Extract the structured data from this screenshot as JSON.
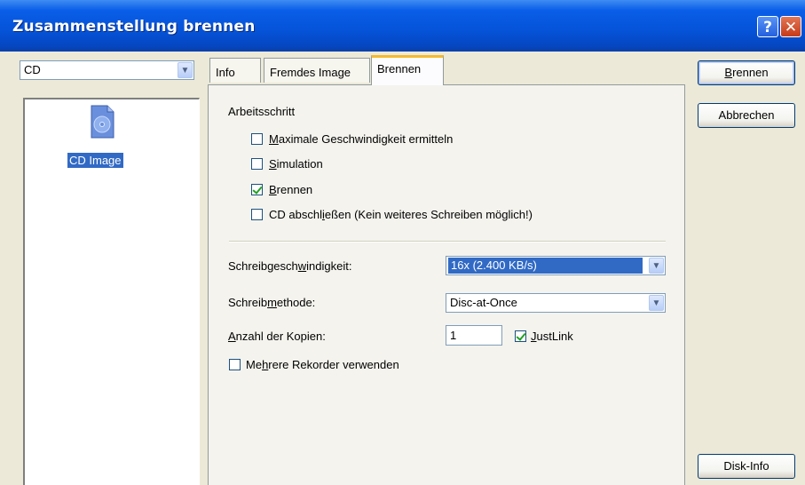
{
  "window": {
    "title": "Zusammenstellung brennen"
  },
  "left": {
    "combo_value": "CD",
    "items": [
      {
        "label": "CD Image",
        "icon": "cd-image-icon"
      }
    ]
  },
  "tabs": [
    {
      "label": "Info"
    },
    {
      "label": "Fremdes Image"
    },
    {
      "label": "Brennen",
      "active": true
    }
  ],
  "burn": {
    "group_label": "Arbeitsschritt",
    "options": [
      {
        "pre": "",
        "key": "M",
        "post": "aximale Geschwindigkeit ermitteln",
        "checked": false
      },
      {
        "pre": "",
        "key": "S",
        "post": "imulation",
        "checked": false
      },
      {
        "pre": "",
        "key": "B",
        "post": "rennen",
        "checked": true
      },
      {
        "pre": "CD abschl",
        "key": "i",
        "post": "eßen (Kein weiteres Schreiben möglich!)",
        "checked": false
      }
    ],
    "speed": {
      "pre": "Schreibgesch",
      "key": "w",
      "post": "indigkeit:",
      "value": "16x (2.400 KB/s)"
    },
    "method": {
      "pre": "Schreib",
      "key": "m",
      "post": "ethode:",
      "value": "Disc-at-Once"
    },
    "copies": {
      "pre": "",
      "key": "A",
      "post": "nzahl der Kopien:",
      "value": "1"
    },
    "justlink": {
      "pre": "",
      "key": "J",
      "post": "ustLink",
      "checked": true
    },
    "multi": {
      "pre": "Me",
      "key": "h",
      "post": "rere Rekorder verwenden",
      "checked": false
    }
  },
  "buttons": {
    "burn": {
      "key": "B",
      "post": "rennen"
    },
    "cancel": "Abbrechen",
    "diskinfo": "Disk-Info"
  },
  "colors": {
    "titlebar": "#0553d8",
    "selection": "#316ac5",
    "check": "#21a121"
  }
}
